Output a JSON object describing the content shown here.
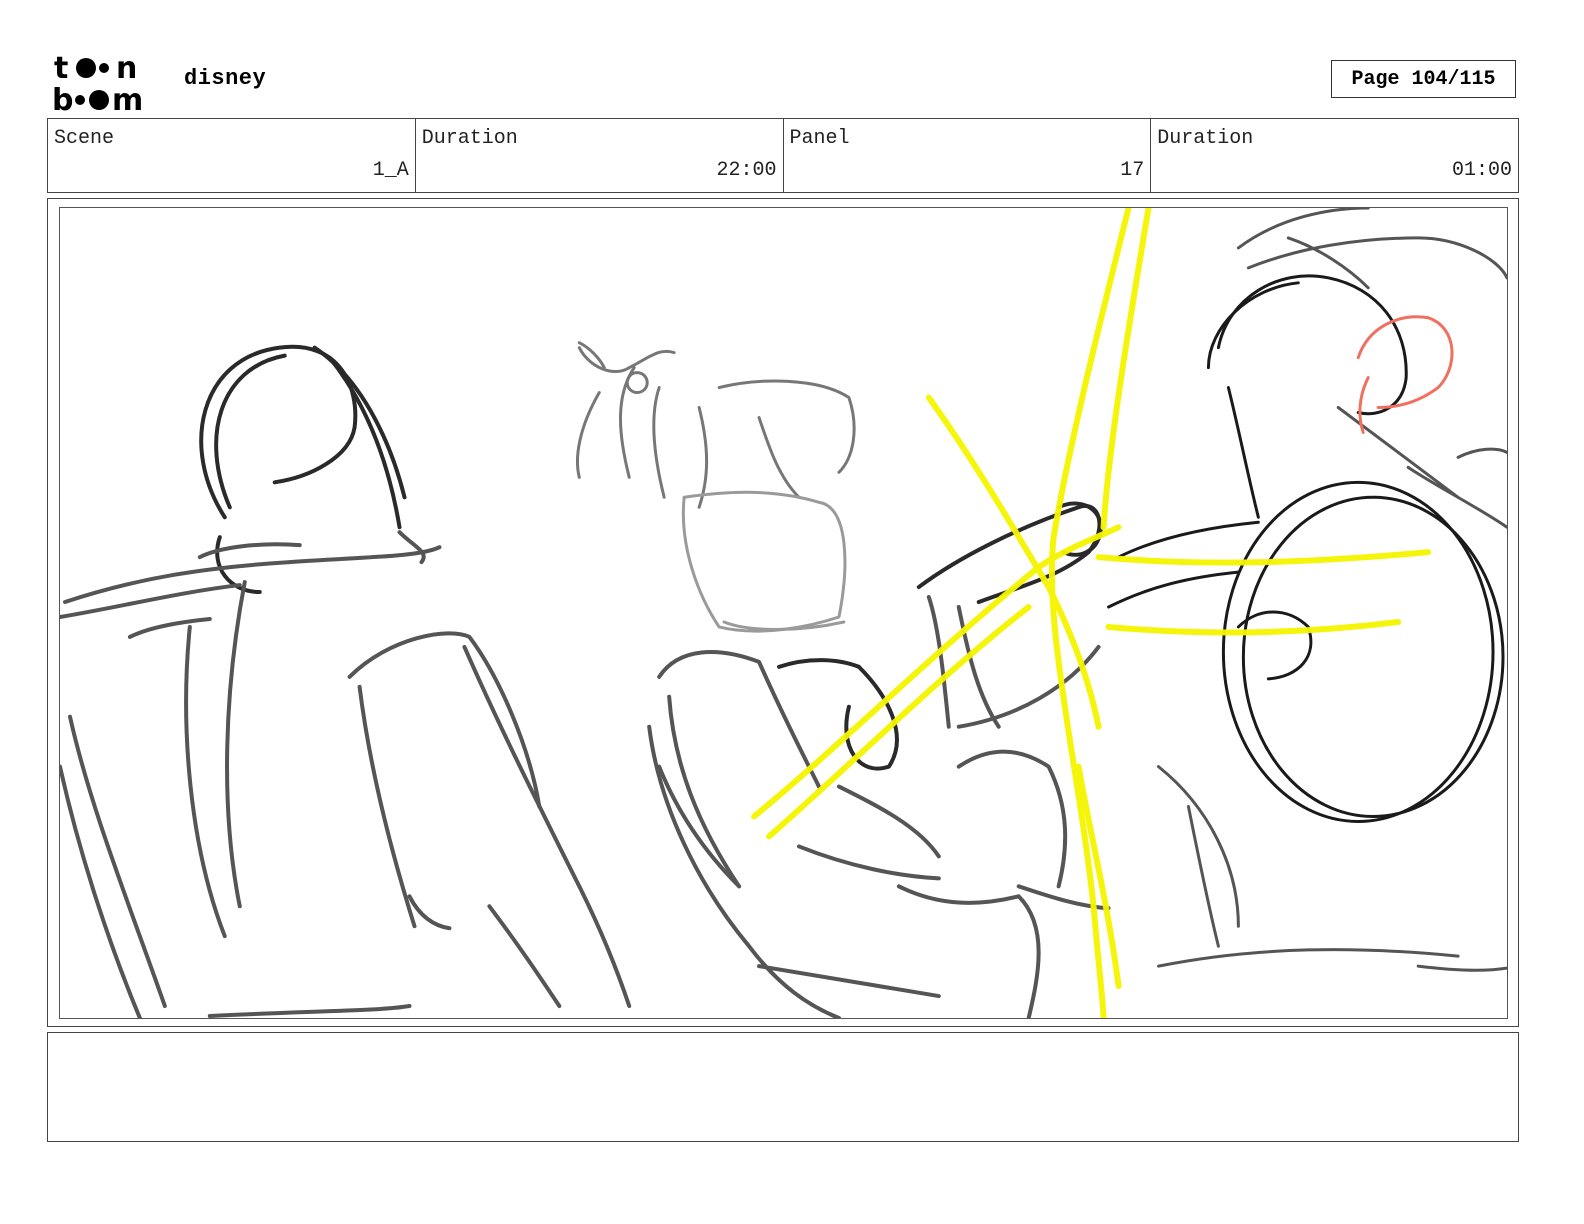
{
  "header": {
    "logo_text": "toon boom",
    "project": "disney",
    "page": "Page 104/115"
  },
  "info": [
    {
      "label": "Scene",
      "value": "1_A"
    },
    {
      "label": "Duration",
      "value": "22:00"
    },
    {
      "label": "Panel",
      "value": "17"
    },
    {
      "label": "Duration",
      "value": "01:00"
    }
  ],
  "panel": {
    "image": "rough storyboard sketch",
    "colors": {
      "dark_line": "#2a2a2a",
      "mid_line": "#555555",
      "light_line": "#9a9a9a",
      "highlight": "#f5f500",
      "accent": "#f07060"
    }
  },
  "notes": ""
}
